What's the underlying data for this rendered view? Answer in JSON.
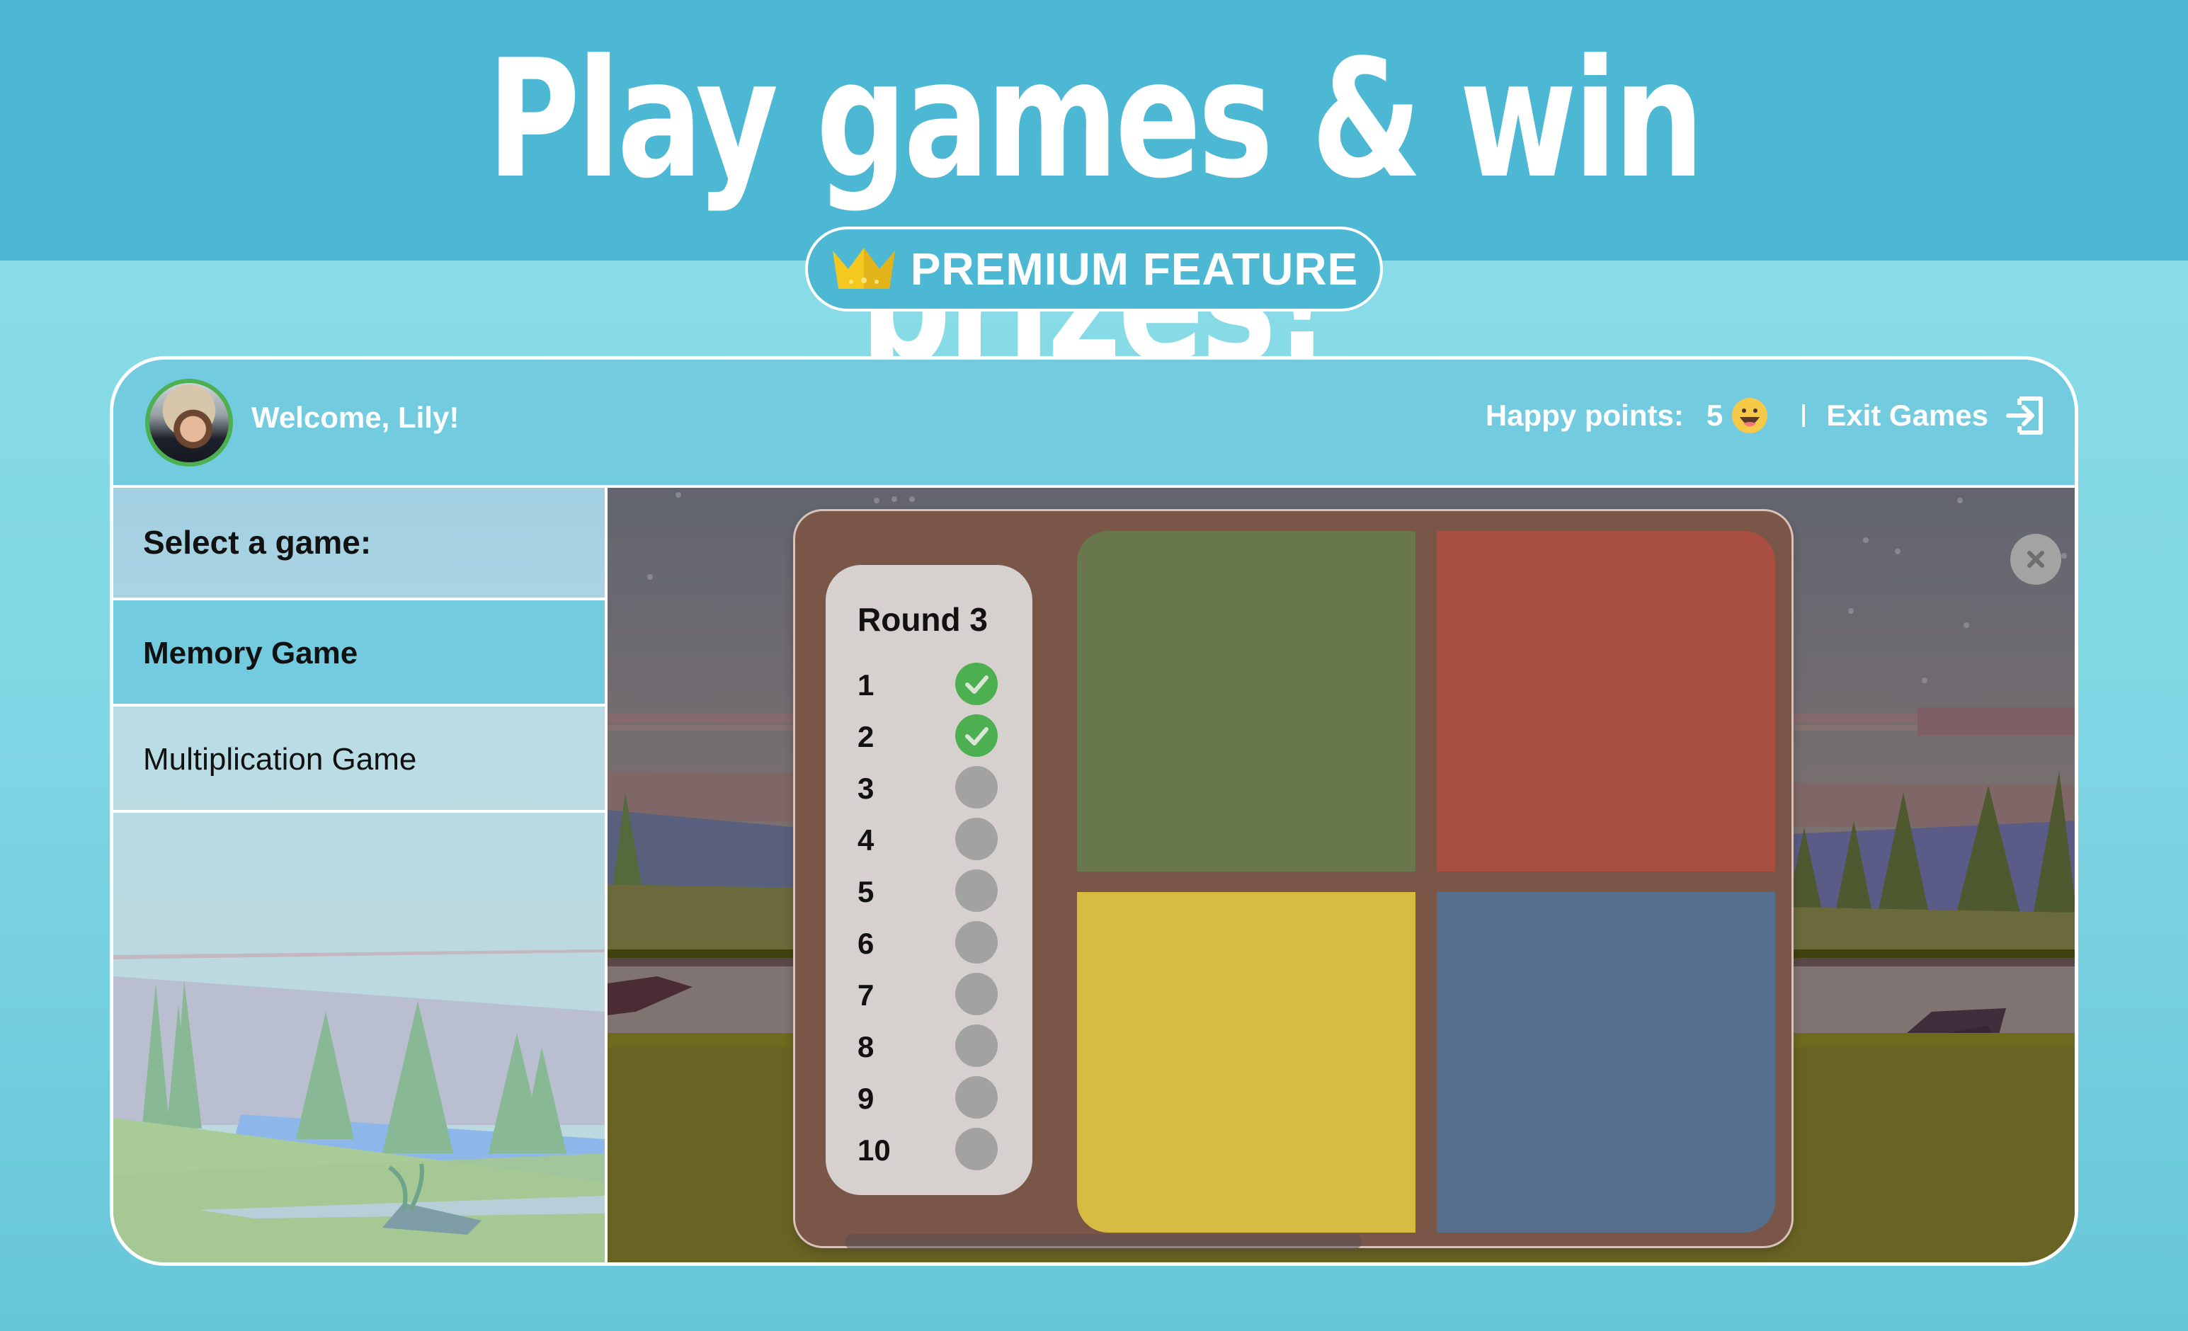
{
  "hero": {
    "title": "Play games & win prizes!",
    "badge_label": "PREMIUM FEATURE",
    "badge_icon": "crown-icon"
  },
  "header": {
    "welcome": "Welcome, Lily!",
    "avatar_alt": "Lily",
    "points_label": "Happy points:",
    "points_value": "5",
    "points_icon": "smiley-icon",
    "exit_label": "Exit Games",
    "exit_icon": "exit-icon"
  },
  "sidebar": {
    "heading": "Select a game:",
    "items": [
      {
        "label": "Memory Game",
        "active": true
      },
      {
        "label": "Multiplication Game",
        "active": false
      }
    ]
  },
  "game": {
    "close_icon": "close-icon",
    "round_title": "Round 3",
    "rounds": [
      {
        "label": "1",
        "status": "done"
      },
      {
        "label": "2",
        "status": "done"
      },
      {
        "label": "3",
        "status": "pending"
      },
      {
        "label": "4",
        "status": "pending"
      },
      {
        "label": "5",
        "status": "pending"
      },
      {
        "label": "6",
        "status": "pending"
      },
      {
        "label": "7",
        "status": "pending"
      },
      {
        "label": "8",
        "status": "pending"
      },
      {
        "label": "9",
        "status": "pending"
      },
      {
        "label": "10",
        "status": "pending"
      }
    ],
    "tiles": [
      {
        "name": "green",
        "color": "#68784c"
      },
      {
        "name": "red",
        "color": "#a94f42"
      },
      {
        "name": "yellow",
        "color": "#d6bd42"
      },
      {
        "name": "blue",
        "color": "#566f8c"
      }
    ]
  },
  "colors": {
    "brand_blue": "#4db8d4",
    "header_blue": "#72cbdf",
    "board_brown": "#7a5649",
    "done_green": "#4caf50",
    "pending_gray": "#a2a2a2"
  }
}
